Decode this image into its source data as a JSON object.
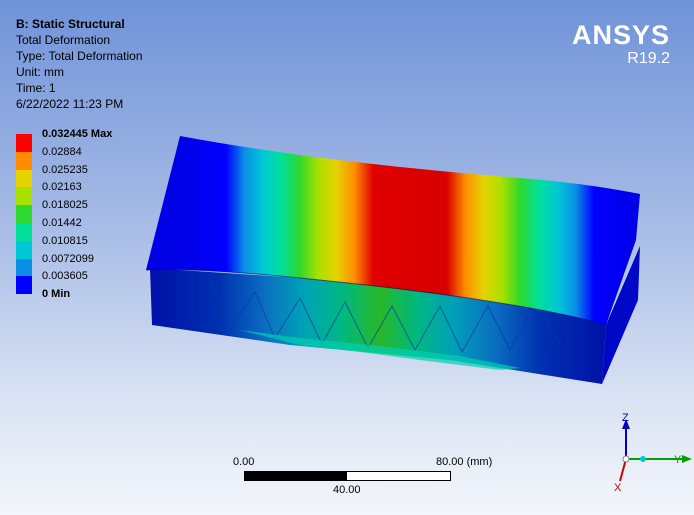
{
  "header": {
    "title": "B: Static Structural",
    "result_name": "Total Deformation",
    "type_line": "Type: Total Deformation",
    "unit_line": "Unit: mm",
    "time_line": "Time: 1",
    "timestamp": "6/22/2022 11:23 PM"
  },
  "brand": {
    "name": "ANSYS",
    "version": "R19.2"
  },
  "legend": {
    "max_label": "0.032445 Max",
    "min_label": "0 Min",
    "labels": [
      "0.032445 Max",
      "0.02884",
      "0.025235",
      "0.02163",
      "0.018025",
      "0.01442",
      "0.010815",
      "0.0072099",
      "0.003605",
      "0 Min"
    ],
    "colors": [
      "#ff0000",
      "#ff8c00",
      "#e6d200",
      "#a8e000",
      "#2ed82e",
      "#00e09a",
      "#00c8d6",
      "#0a8ee6",
      "#0000ff"
    ]
  },
  "scale_bar": {
    "start": "0.00",
    "end": "80.00 (mm)",
    "mid": "40.00"
  },
  "triad": {
    "z_label": "Z",
    "y_label": "Y",
    "x_label": "X"
  }
}
